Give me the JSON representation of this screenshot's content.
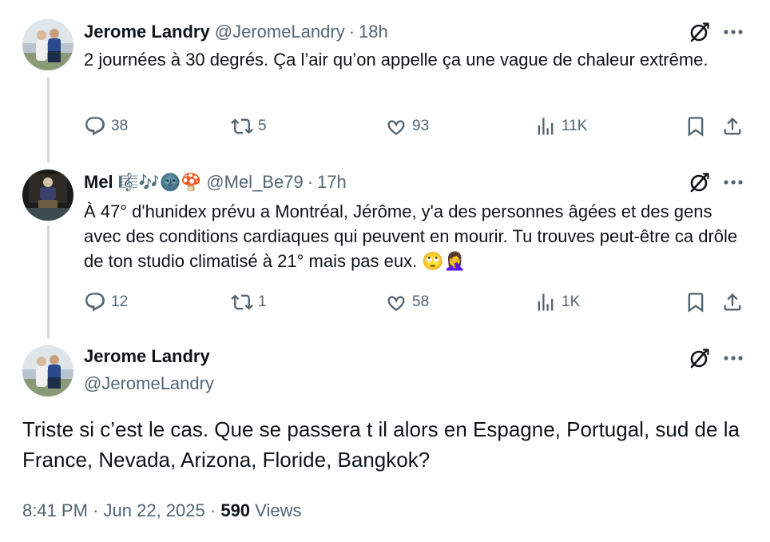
{
  "reply1": {
    "name": "Jerome Landry",
    "handle": "@JeromeLandry",
    "separator": "·",
    "time": "18h",
    "text": "2 journées à 30 degrés. Ça l’air qu’on appelle ça une vague de chaleur extrême.",
    "replies": "38",
    "reposts": "5",
    "likes": "93",
    "views": "11K"
  },
  "reply2": {
    "name": "Mel",
    "name_emojis": "🎼🎶🌚🍄",
    "handle": "@Mel_Be79",
    "separator": "·",
    "time": "17h",
    "text": "À 47° d'hunidex prévu a Montréal, Jérôme, y'a des personnes âgées et des gens avec des conditions cardiaques qui peuvent en mourir. Tu trouves peut-être ca drôle de ton studio climatisé à 21° mais pas eux. 🙄🤦‍♀️",
    "replies": "12",
    "reposts": "1",
    "likes": "58",
    "views": "1K"
  },
  "main": {
    "name": "Jerome Landry",
    "handle": "@JeromeLandry",
    "text": "Triste si c’est le cas. Que se passera t il alors en Espagne, Portugal, sud de la France, Nevada, Arizona, Floride, Bangkok?",
    "time": "8:41 PM",
    "separator": "·",
    "date": "Jun 22, 2025",
    "views_count": "590",
    "views_label": "Views"
  },
  "icons": {
    "reply": "reply-icon",
    "repost": "repost-icon",
    "like": "heart-icon",
    "views": "views-icon",
    "bookmark": "bookmark-icon",
    "share": "share-icon",
    "grok": "grok-icon",
    "more": "more-icon"
  },
  "colors": {
    "text": "#0f1419",
    "secondary": "#536471",
    "thread_line": "#cfd9de"
  }
}
